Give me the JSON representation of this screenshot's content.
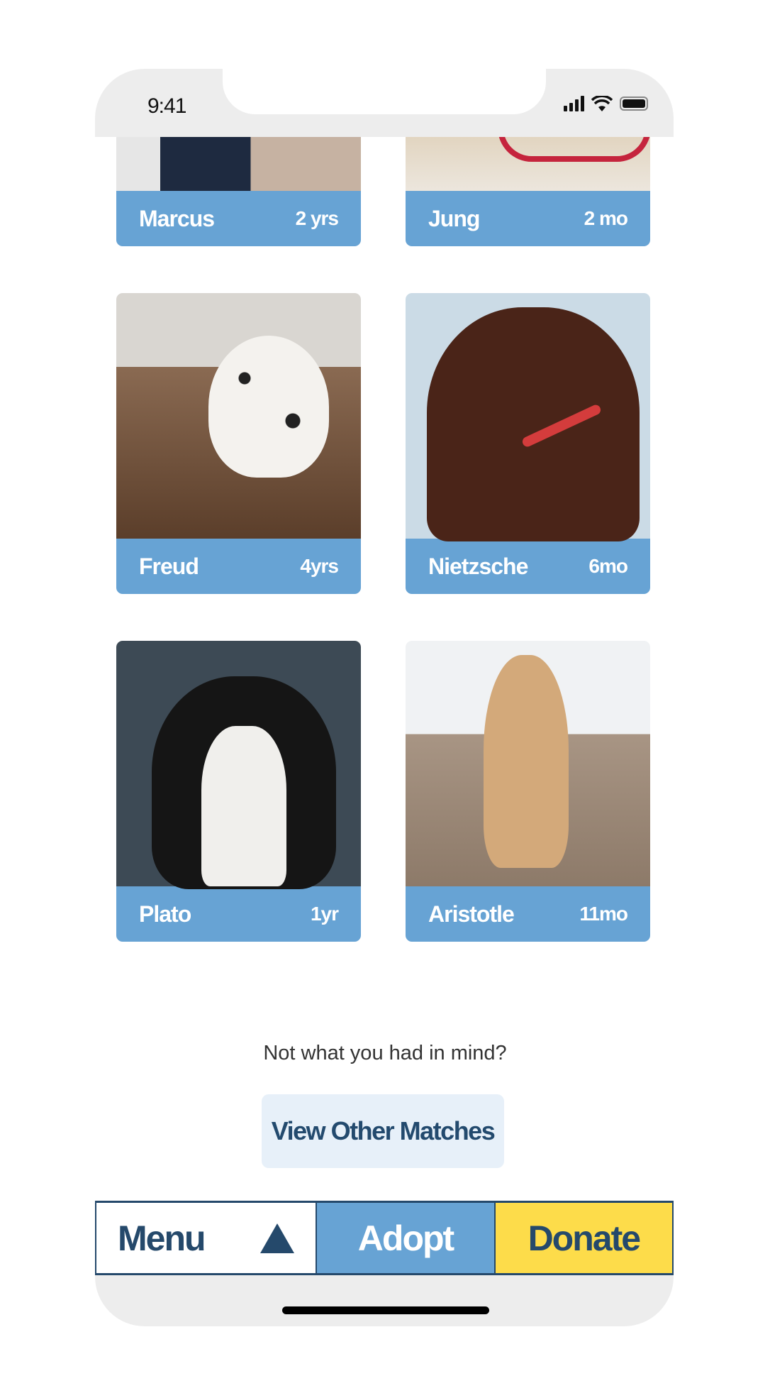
{
  "status_bar": {
    "time": "9:41",
    "icons": [
      "cellular-signal-icon",
      "wifi-icon",
      "battery-icon"
    ]
  },
  "pets": [
    {
      "name": "Marcus",
      "age": "2 yrs",
      "photo": "dog-in-dark-sweater"
    },
    {
      "name": "Jung",
      "age": "2 mo",
      "photo": "dog-with-red-collar"
    },
    {
      "name": "Freud",
      "age": "4yrs",
      "photo": "dalmatian-lying-on-floor"
    },
    {
      "name": "Nietzsche",
      "age": "6mo",
      "photo": "chocolate-labrador-profile"
    },
    {
      "name": "Plato",
      "age": "1yr",
      "photo": "border-collie-smiling"
    },
    {
      "name": "Aristotle",
      "age": "11mo",
      "photo": "spaniel-puppy-on-beach"
    }
  ],
  "prompt_text": "Not what you had in mind?",
  "other_matches_label": "View Other Matches",
  "nav": {
    "menu": "Menu",
    "adopt": "Adopt",
    "donate": "Donate"
  },
  "colors": {
    "card_label": "#67a3d4",
    "navy": "#25496b",
    "donate": "#fddc4a",
    "secondary_button": "#e7f0f9"
  }
}
